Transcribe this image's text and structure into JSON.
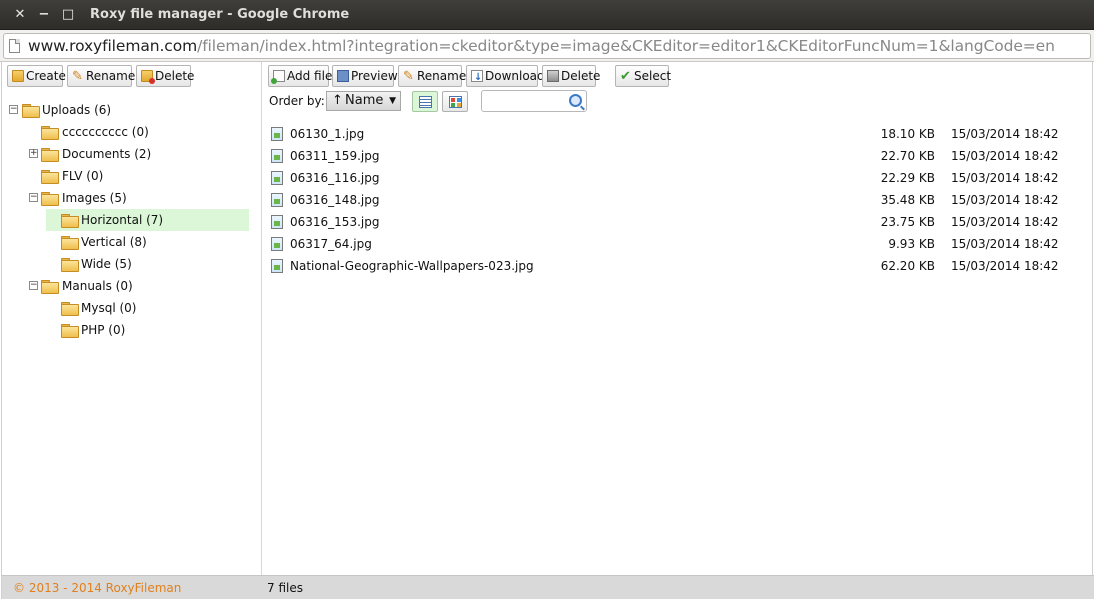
{
  "window": {
    "title": "Roxy file manager - Google Chrome",
    "close": "✕",
    "minimize": "−",
    "maximize": "□"
  },
  "address": {
    "host": "www.roxyfileman.com",
    "path": "/fileman/index.html?integration=ckeditor&type=image&CKEditor=editor1&CKEditorFuncNum=1&langCode=en"
  },
  "left_toolbar": {
    "create": "Create",
    "rename": "Rename",
    "delete": "Delete"
  },
  "right_toolbar": {
    "add_file": "Add file",
    "preview": "Preview",
    "rename": "Rename",
    "download": "Download",
    "delete": "Delete",
    "select": "Select"
  },
  "order": {
    "label": "Order by:",
    "direction": "↑",
    "field": "Name",
    "dropdown": "▼"
  },
  "search": {
    "placeholder": ""
  },
  "tree": [
    {
      "label": "Uploads (6)",
      "expander": "⊟"
    },
    {
      "label": "cccccccccc (0)"
    },
    {
      "label": "Documents (2)",
      "expander": "+"
    },
    {
      "label": "FLV (0)"
    },
    {
      "label": "Images (5)",
      "expander": "−"
    },
    {
      "label": "Horizontal (7)",
      "selected": true
    },
    {
      "label": "Vertical (8)"
    },
    {
      "label": "Wide (5)"
    },
    {
      "label": "Manuals (0)",
      "expander": "−"
    },
    {
      "label": "Mysql (0)"
    },
    {
      "label": "PHP (0)"
    }
  ],
  "files": [
    {
      "name": "06130_1.jpg",
      "size": "18.10 KB",
      "date": "15/03/2014 18:42"
    },
    {
      "name": "06311_159.jpg",
      "size": "22.70 KB",
      "date": "15/03/2014 18:42"
    },
    {
      "name": "06316_116.jpg",
      "size": "22.29 KB",
      "date": "15/03/2014 18:42"
    },
    {
      "name": "06316_148.jpg",
      "size": "35.48 KB",
      "date": "15/03/2014 18:42"
    },
    {
      "name": "06316_153.jpg",
      "size": "23.75 KB",
      "date": "15/03/2014 18:42"
    },
    {
      "name": "06317_64.jpg",
      "size": "9.93 KB",
      "date": "15/03/2014 18:42"
    },
    {
      "name": "National-Geographic-Wallpapers-023.jpg",
      "size": "62.20 KB",
      "date": "15/03/2014 18:42"
    }
  ],
  "status": {
    "copyright": "© 2013 - 2014 RoxyFileman",
    "file_count": "7 files"
  },
  "colors": {
    "selection": "#dcf7d8",
    "copyright": "#e0801e"
  }
}
